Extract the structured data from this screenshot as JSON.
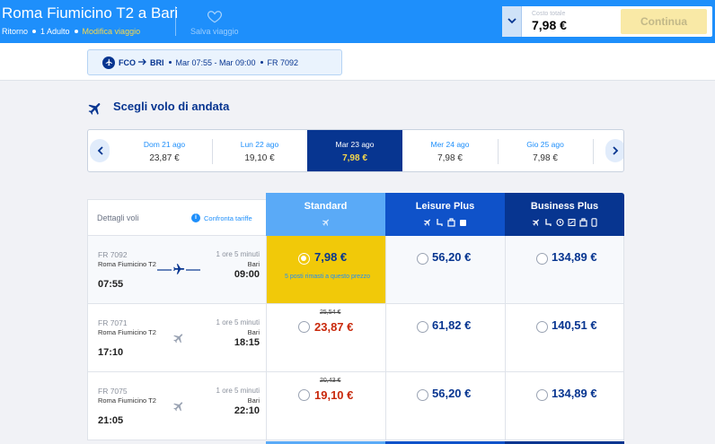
{
  "header": {
    "title": "Roma Fiumicino T2 a Bari",
    "trip_type": "Ritorno",
    "passengers": "1 Adulto",
    "modify_label": "Modifica viaggio",
    "save_label": "Salva viaggio",
    "total_label": "Costo totale",
    "total_value": "7,98 €",
    "continue_label": "Continua"
  },
  "summary": {
    "from": "FCO",
    "to": "BRI",
    "schedule": "Mar 07:55 - Mar 09:00",
    "flight": "FR 7092"
  },
  "section": {
    "title": "Scegli volo di andata"
  },
  "dates": [
    {
      "label": "Dom 21 ago",
      "price": "23,87 €",
      "selected": false
    },
    {
      "label": "Lun 22 ago",
      "price": "19,10 €",
      "selected": false
    },
    {
      "label": "Mar 23 ago",
      "price": "7,98 €",
      "selected": true
    },
    {
      "label": "Mer 24 ago",
      "price": "7,98 €",
      "selected": false
    },
    {
      "label": "Gio 25 ago",
      "price": "7,98 €",
      "selected": false
    }
  ],
  "table": {
    "details_label": "Dettagli voli",
    "compare_label": "Confronta tariffe",
    "fares": [
      {
        "name": "Standard",
        "color": "#5aaaf7"
      },
      {
        "name": "Leisure Plus",
        "color": "#0f52c9"
      },
      {
        "name": "Business Plus",
        "color": "#073590"
      }
    ],
    "flights": [
      {
        "code": "FR 7092",
        "from": "Roma Fiumicino T2",
        "departure": "07:55",
        "duration": "1 ore 5 minuti",
        "to": "Bari",
        "arrival": "09:00",
        "standard": {
          "price": "7,98 €",
          "old_price": "",
          "note": "5 posti rimasti a questo prezzo",
          "selected": true
        },
        "leisure": "56,20 €",
        "business": "134,89 €"
      },
      {
        "code": "FR 7071",
        "from": "Roma Fiumicino T2",
        "departure": "17:10",
        "duration": "1 ore 5 minuti",
        "to": "Bari",
        "arrival": "18:15",
        "standard": {
          "price": "23,87 €",
          "old_price": "25,54 €",
          "note": "",
          "selected": false
        },
        "leisure": "61,82 €",
        "business": "140,51 €"
      },
      {
        "code": "FR 7075",
        "from": "Roma Fiumicino T2",
        "departure": "21:05",
        "duration": "1 ore 5 minuti",
        "to": "Bari",
        "arrival": "22:10",
        "standard": {
          "price": "19,10 €",
          "old_price": "20,43 €",
          "note": "",
          "selected": false
        },
        "leisure": "56,20 €",
        "business": "134,89 €"
      }
    ]
  },
  "colors": {
    "brand_blue": "#073590",
    "accent_blue": "#1e8ffb",
    "yellow": "#f1c909",
    "discount_red": "#c9290c"
  }
}
